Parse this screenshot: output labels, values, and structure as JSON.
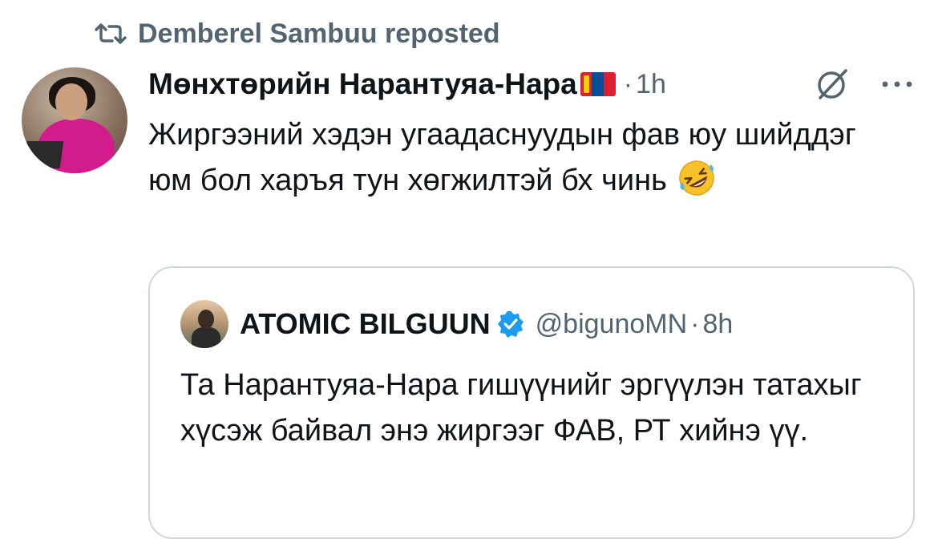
{
  "repost": {
    "icon": "repost-icon",
    "text": "Demberel Sambuu reposted"
  },
  "tweet": {
    "author_name": "Мөнхтөрийн Нарантуяа-Нара",
    "flag_icon": "mongolia-flag-icon",
    "dot": "·",
    "time": "1h",
    "text": "Жиргээний хэдэн угаадаснуудын фав юу шийддэг юм бол харъя тун хөгжилтэй бх чинь",
    "emoji": "rolling-on-floor-laughing-emoji"
  },
  "quote": {
    "author_name": "ATOMIC BILGUUN",
    "handle": "@bigunoMN",
    "dot": "·",
    "time": "8h",
    "text": "Та Нарантуяа-Нара гишүүнийг эргүүлэн татахыг хүсэж байвал энэ жиргээг ФАВ, РТ хийнэ үү."
  },
  "colors": {
    "text_primary": "#0f1419",
    "text_secondary": "#536471",
    "verified_blue": "#1d9bf0",
    "card_border": "#cfd9de"
  }
}
